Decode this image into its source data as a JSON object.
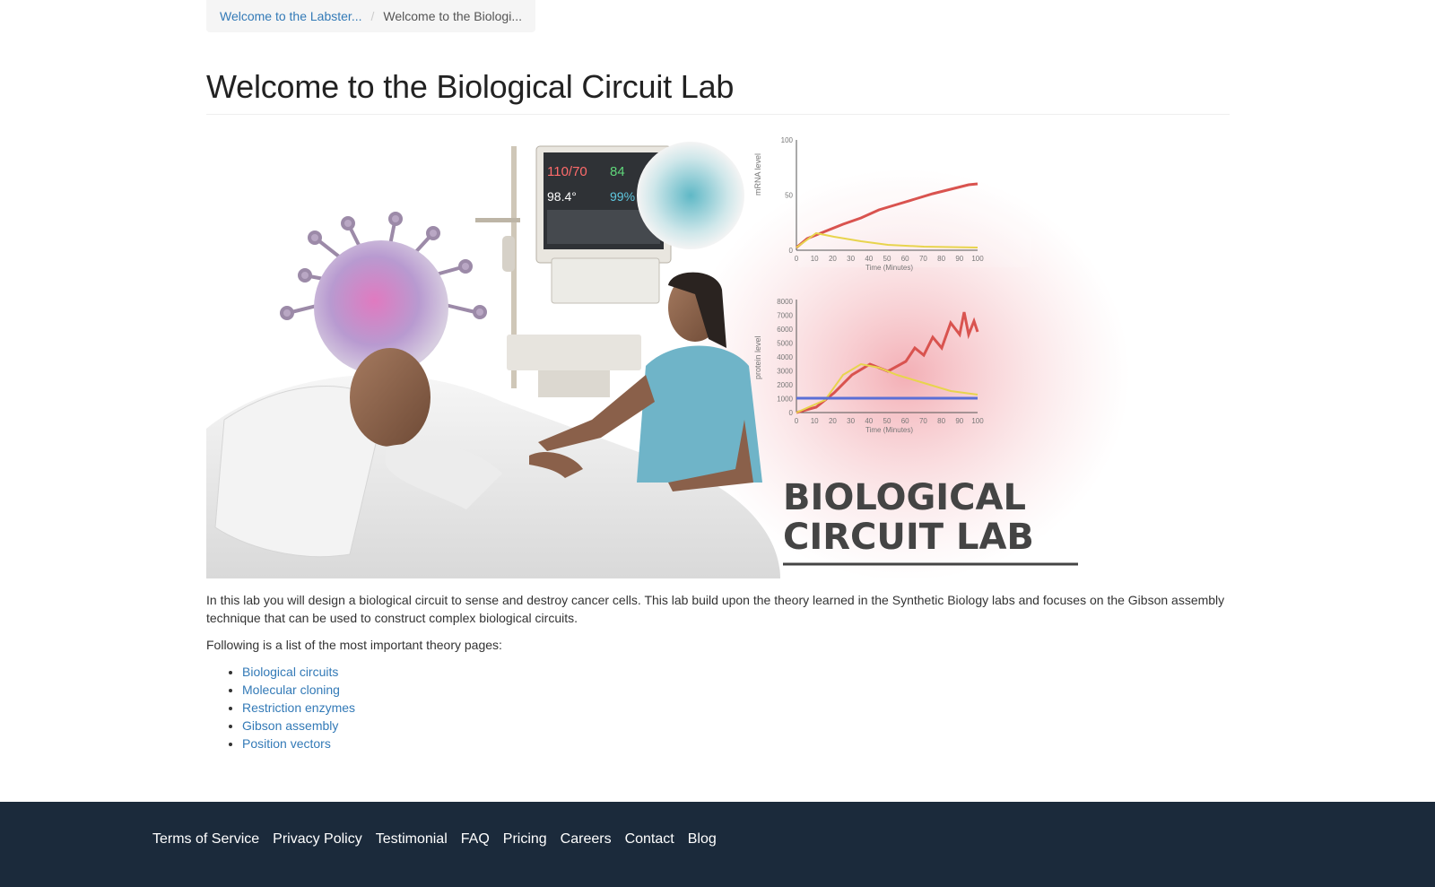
{
  "breadcrumb": {
    "items": [
      {
        "label": "Welcome to the Labster..."
      },
      {
        "label": "Welcome to the Biologi..."
      }
    ],
    "separator": "/"
  },
  "page": {
    "title": "Welcome to the Biological Circuit Lab"
  },
  "banner": {
    "title_line1": "BIOLOGICAL",
    "title_line2": "CIRCUIT LAB",
    "monitor": {
      "bp": "110/70",
      "pulse": "84",
      "temp": "98.4°",
      "spo2": "99%"
    },
    "chart_top": {
      "ylabel": "mRNA level",
      "xlabel": "Time (Minutes)",
      "yticks": [
        "100",
        "50",
        "0"
      ],
      "xticks": [
        "0",
        "10",
        "20",
        "30",
        "40",
        "50",
        "60",
        "70",
        "80",
        "90",
        "100"
      ]
    },
    "chart_bottom": {
      "ylabel": "protein level",
      "xlabel": "Time (Minutes)",
      "yticks": [
        "8000",
        "7000",
        "6000",
        "5000",
        "4000",
        "3000",
        "2000",
        "1000",
        "0"
      ],
      "xticks": [
        "0",
        "10",
        "20",
        "30",
        "40",
        "50",
        "60",
        "70",
        "80",
        "90",
        "100"
      ]
    }
  },
  "content": {
    "intro": "In this lab you will design a biological circuit to sense and destroy cancer cells. This lab build upon the theory learned in the Synthetic Biology labs and focuses on the Gibson assembly technique that can be used to construct complex biological circuits.",
    "list_intro": "Following is a list of the most important theory pages:",
    "links": [
      {
        "label": "Biological circuits"
      },
      {
        "label": "Molecular cloning"
      },
      {
        "label": "Restriction enzymes"
      },
      {
        "label": "Gibson assembly"
      },
      {
        "label": "Position vectors"
      }
    ]
  },
  "footer": {
    "links": [
      {
        "label": "Terms of Service"
      },
      {
        "label": "Privacy Policy"
      },
      {
        "label": "Testimonial"
      },
      {
        "label": "FAQ"
      },
      {
        "label": "Pricing"
      },
      {
        "label": "Careers"
      },
      {
        "label": "Contact"
      },
      {
        "label": "Blog"
      }
    ]
  },
  "colors": {
    "link": "#337ab7",
    "footer_bg": "#1b2a3b",
    "chart_red": "#d9534f",
    "chart_yellow": "#e8d44d",
    "chart_blue": "#5b6fd6"
  }
}
